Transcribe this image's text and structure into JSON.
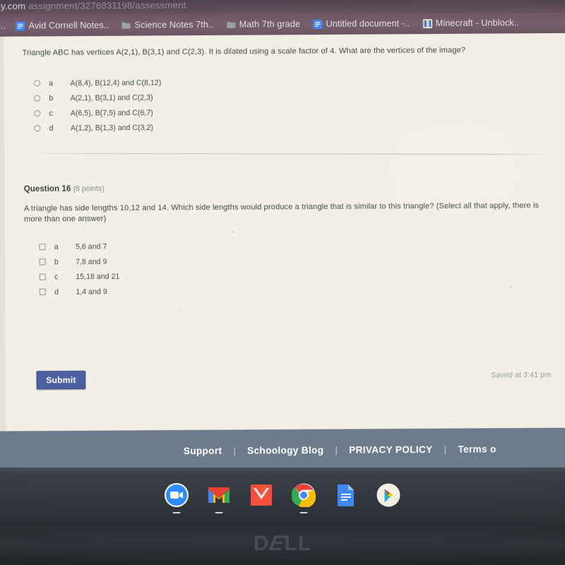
{
  "browser": {
    "omnibox": {
      "host": "gy.com",
      "path": "assignment/3276831198/assessment"
    },
    "bookmarks": [
      {
        "label": "e..",
        "icon": "google-docs-icon"
      },
      {
        "label": "Avid Cornell Notes..",
        "icon": "google-docs-icon"
      },
      {
        "label": "Science Notes 7th..",
        "icon": "folder-icon"
      },
      {
        "label": "Math 7th grade",
        "icon": "folder-icon"
      },
      {
        "label": "Untitled document -..",
        "icon": "google-docs-icon"
      },
      {
        "label": "Minecraft - Unblock..",
        "icon": "generic-site-icon"
      }
    ]
  },
  "assessment": {
    "question_15": {
      "prompt": "Triangle ABC has vertices A(2,1), B(3,1) and C(2,3).  It is dilated using a scale factor of 4.  What are the vertices of the image?",
      "input_type": "radio",
      "choices": [
        {
          "letter": "a",
          "text": "A(8,4), B(12,4) and C(8,12)",
          "selected": false
        },
        {
          "letter": "b",
          "text": "A(2,1), B(3,1) and C(2,3)",
          "selected": false
        },
        {
          "letter": "c",
          "text": "A(6,5), B(7,5) and C(6,7)",
          "selected": false
        },
        {
          "letter": "d",
          "text": "A(1,2), B(1,3) and C(3,2)",
          "selected": false
        }
      ]
    },
    "question_16": {
      "title": "Question 16",
      "points": "(8 points)",
      "prompt": "A triangle has side lengths 10,12 and 14.  Which side lengths would produce a triangle that is similar to this triangle? (Select all that apply, there is more than one answer)",
      "input_type": "checkbox",
      "choices": [
        {
          "letter": "a",
          "text": "5,6 and 7",
          "checked": false
        },
        {
          "letter": "b",
          "text": "7,8 and 9",
          "checked": false
        },
        {
          "letter": "c",
          "text": "15,18 and 21",
          "checked": false
        },
        {
          "letter": "d",
          "text": "1,4 and 9",
          "checked": false
        }
      ]
    },
    "submit_label": "Submit",
    "saved_status": "Saved at 3:41 pm"
  },
  "footer": {
    "links": [
      "Support",
      "Schoology Blog",
      "PRIVACY POLICY",
      "Terms o"
    ],
    "separator": "|"
  },
  "shelf": {
    "apps": [
      {
        "name": "zoom-icon",
        "running": true
      },
      {
        "name": "gmail-icon",
        "running": true
      },
      {
        "name": "inbox-mail-icon",
        "running": false
      },
      {
        "name": "chrome-icon",
        "running": true
      },
      {
        "name": "google-docs-icon",
        "running": false
      },
      {
        "name": "google-play-store-icon",
        "running": false
      }
    ]
  },
  "device": {
    "brand": "DELL"
  },
  "colors": {
    "omnibox_bg": "#5a4a55",
    "bookmarkbar_bg": "#77606c",
    "page_bg": "#f2efe5",
    "footer_bg": "#6d7b8c",
    "shelf_bg": "#343a40",
    "submit_bg": "#4e5fa0",
    "bezel_bg": "#2e343a"
  }
}
